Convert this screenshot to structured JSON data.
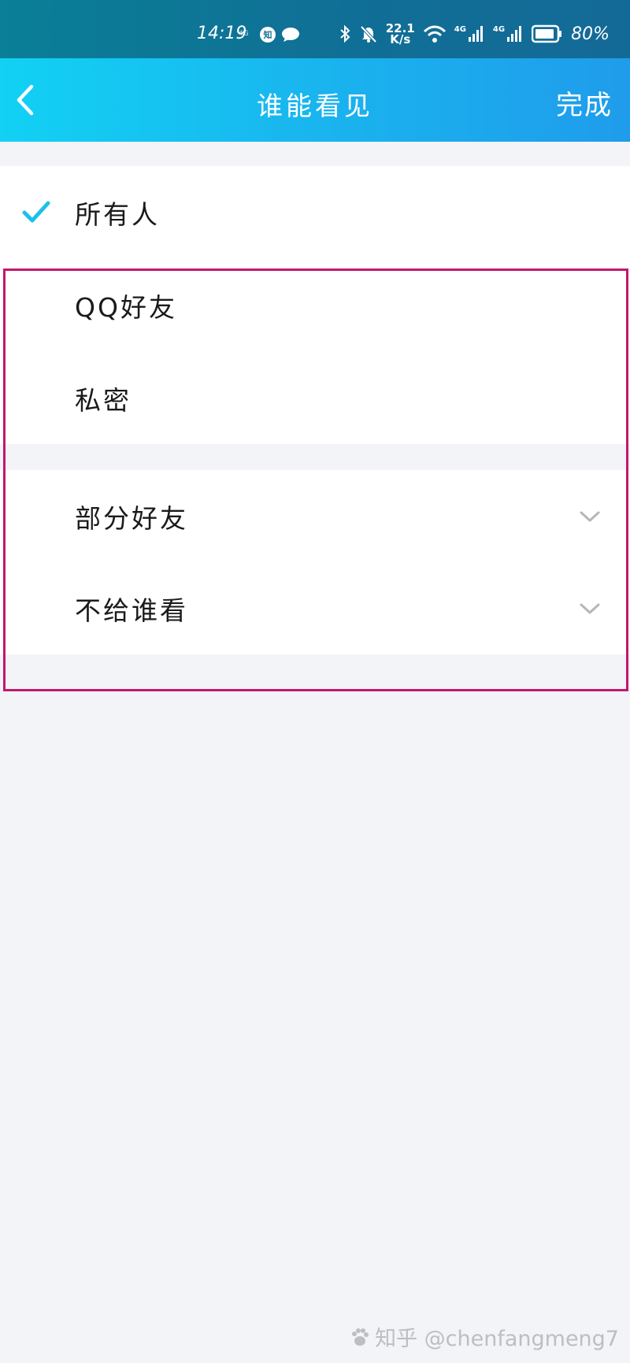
{
  "status_bar": {
    "time": "14:19",
    "small_net": "4G",
    "app_badge": "知",
    "speed_value": "22.1",
    "speed_unit": "K/s",
    "net1": "4G",
    "net2": "4G",
    "battery_percent": "80%"
  },
  "nav": {
    "title": "谁能看见",
    "done_label": "完成"
  },
  "options": {
    "everyone": {
      "label": "所有人",
      "selected": true
    },
    "qq_friends": {
      "label": "QQ好友",
      "selected": false
    },
    "private": {
      "label": "私密",
      "selected": false
    },
    "some_friends": {
      "label": "部分好友",
      "selected": false
    },
    "hide_from": {
      "label": "不给谁看",
      "selected": false
    }
  },
  "colors": {
    "accent_check": "#1ec0ea",
    "highlight_border": "#c4176c",
    "nav_gradient_start": "#12d1f4",
    "nav_gradient_end": "#1f9ceb"
  },
  "watermark": "知乎 @chenfangmeng7"
}
